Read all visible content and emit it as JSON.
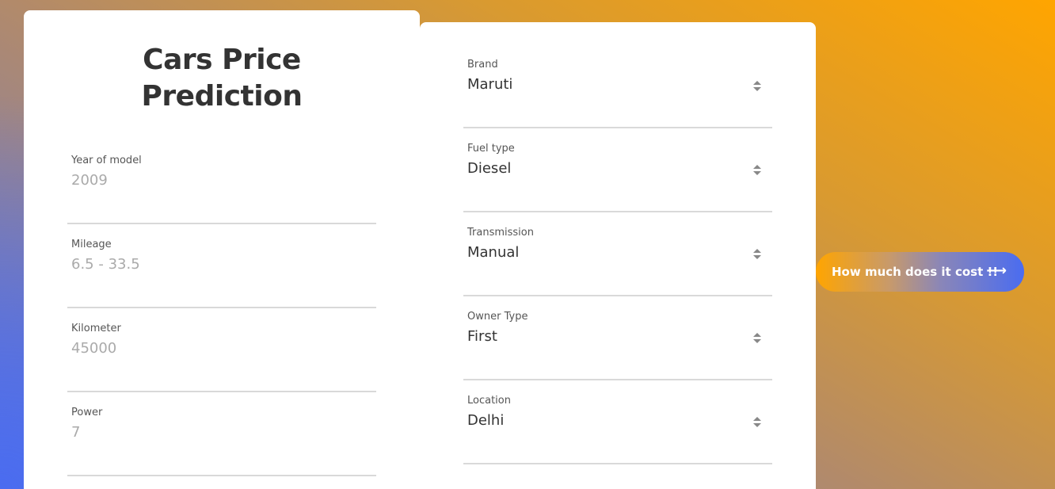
{
  "title_line1": "Cars Price",
  "title_line2": "Prediction",
  "left_fields": [
    {
      "label": "Year of model",
      "placeholder": "2009"
    },
    {
      "label": "Mileage",
      "placeholder": "6.5 - 33.5"
    },
    {
      "label": "Kilometer",
      "placeholder": "45000"
    },
    {
      "label": "Power",
      "placeholder": "7"
    }
  ],
  "right_fields": [
    {
      "label": "Brand",
      "value": "Maruti"
    },
    {
      "label": "Fuel type",
      "value": "Diesel"
    },
    {
      "label": "Transmission",
      "value": "Manual"
    },
    {
      "label": "Owner Type",
      "value": "First"
    },
    {
      "label": "Location",
      "value": "Delhi"
    }
  ],
  "button": {
    "label": "How much does it cost !!",
    "icon": "arrow-right-icon",
    "arrow_glyph": "⟶"
  },
  "colors": {
    "accent_orange": "#ffa500",
    "accent_blue": "#4a6cf0"
  }
}
